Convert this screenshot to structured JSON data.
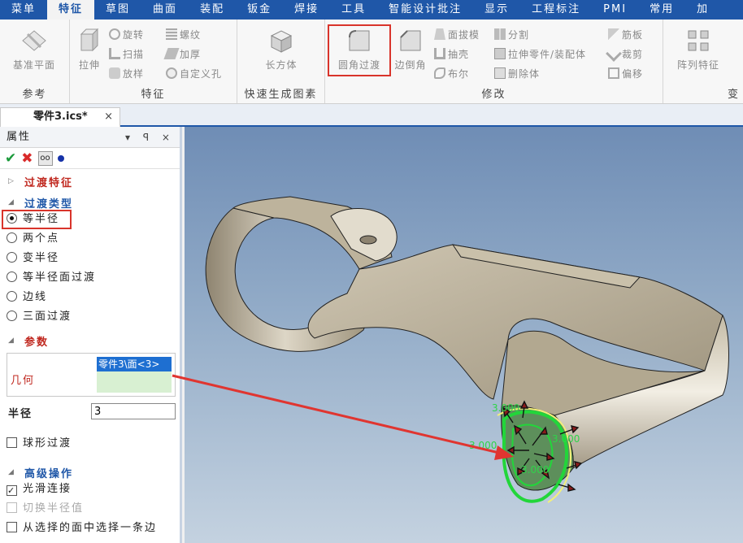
{
  "menu": {
    "items": [
      "菜单",
      "特征",
      "草图",
      "曲面",
      "装配",
      "钣金",
      "焊接",
      "工具",
      "智能设计批注",
      "显示",
      "工程标注",
      "PMI",
      "常用",
      "加"
    ],
    "active_index": 1
  },
  "ribbon": {
    "groups": {
      "reference": "参考",
      "feature": "特征",
      "quick": "快速生成图素",
      "modify": "修改",
      "transform": "变"
    },
    "buttons": {
      "datum_plane": "基准平面",
      "extrude": "拉伸",
      "revolve": "旋转",
      "sweep": "扫描",
      "loft": "放样",
      "thread": "螺纹",
      "thicken": "加厚",
      "custom_hole": "自定义孔",
      "box": "长方体",
      "fillet": "圆角过渡",
      "chamfer": "边倒角",
      "face_draft": "面拔模",
      "shell": "抽壳",
      "boolean": "布尔",
      "split": "分割",
      "extrude_part": "拉伸零件/装配体",
      "delete_body": "删除体",
      "rib": "筋板",
      "trim": "裁剪",
      "offset": "偏移",
      "pattern": "阵列特征"
    }
  },
  "doc_tab": {
    "label": "零件3.ics*",
    "close": "×"
  },
  "panel": {
    "title": "属性",
    "header_icons": "▾ ꟼ ×",
    "fillet_feature": "过渡特征",
    "fillet_type": "过渡类型",
    "types": [
      "等半径",
      "两个点",
      "变半径",
      "等半径面过渡",
      "边线",
      "三面过渡"
    ],
    "selected_type": 0,
    "params": "参数",
    "geometry_label": "几何",
    "geometry_value": "零件3\\面<3>",
    "radius_label": "半径",
    "radius_value": "3",
    "ball_fillet": "球形过渡",
    "advanced": "高级操作",
    "smooth": "光滑连接",
    "switch_radius": "切换半径值",
    "select_edge": "从选择的面中选择一条边"
  },
  "viewport": {
    "dim_labels": [
      "3.000",
      "3.000",
      "3.000",
      "3.000"
    ]
  },
  "colors": {
    "menu_bg": "#1f57a8",
    "highlight": "#d9342b",
    "model": "#b9b09c",
    "selection": "#22d63a"
  }
}
